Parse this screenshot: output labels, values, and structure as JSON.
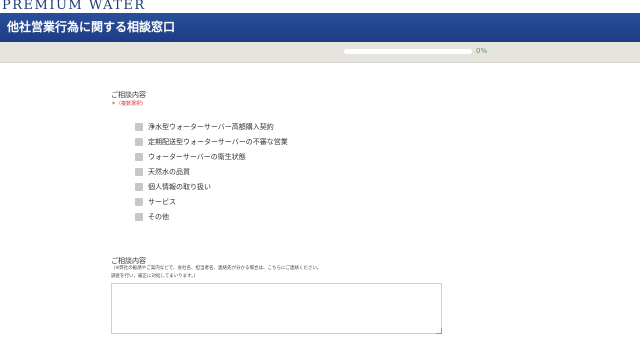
{
  "header": {
    "logo_text": "PREMIUM WATER",
    "title": "他社営業行為に関する相談窓口"
  },
  "progress": {
    "value_percent": 0,
    "label": "0%"
  },
  "form": {
    "consult_section": {
      "label": "ご相談内容",
      "required_note": "＊（複数選択)",
      "options": [
        "浄水型ウォーターサーバー高額購入契約",
        "定期配送型ウォーターサーバーの不審な営業",
        "ウォーターサーバーの衛生状態",
        "天然水の品質",
        "個人情報の取り扱い",
        "サービス",
        "その他"
      ]
    },
    "detail_section": {
      "label": "ご相談内容",
      "note_line1": "（※弊社の勧誘やご案内などで、会社名、担当者名、連絡先が分かる場合は、こちらにご連絡ください。",
      "note_line2": "調査を行い、厳正に対処してまいります。)",
      "textarea_value": ""
    }
  }
}
